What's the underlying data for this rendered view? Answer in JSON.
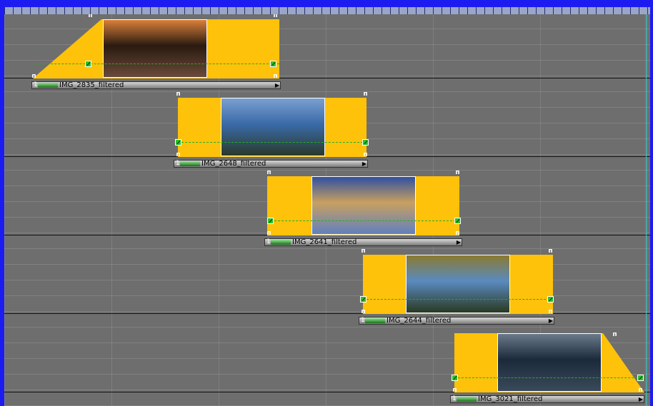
{
  "timeline": {
    "clips": [
      {
        "label": "IMG_2835_filtered",
        "number": "1",
        "thumb_colors": [
          "#2a1a10",
          "#d9803a",
          "#6a4a3a"
        ]
      },
      {
        "label": "IMG_2648_filtered",
        "number": "1",
        "thumb_colors": [
          "#3a6aa8",
          "#7aa0d0",
          "#2a3a2a"
        ]
      },
      {
        "label": "IMG_2641_filtered",
        "number": "1",
        "thumb_colors": [
          "#c8a060",
          "#3050a0",
          "#6080c0"
        ]
      },
      {
        "label": "IMG_2644_filtered",
        "number": "1",
        "thumb_colors": [
          "#5a8ac0",
          "#8a7a30",
          "#2a3a20"
        ]
      },
      {
        "label": "IMG_3021_filtered",
        "number": "1",
        "thumb_colors": [
          "#1a2a3a",
          "#6a7a8a",
          "#3a4a5a"
        ]
      }
    ]
  }
}
